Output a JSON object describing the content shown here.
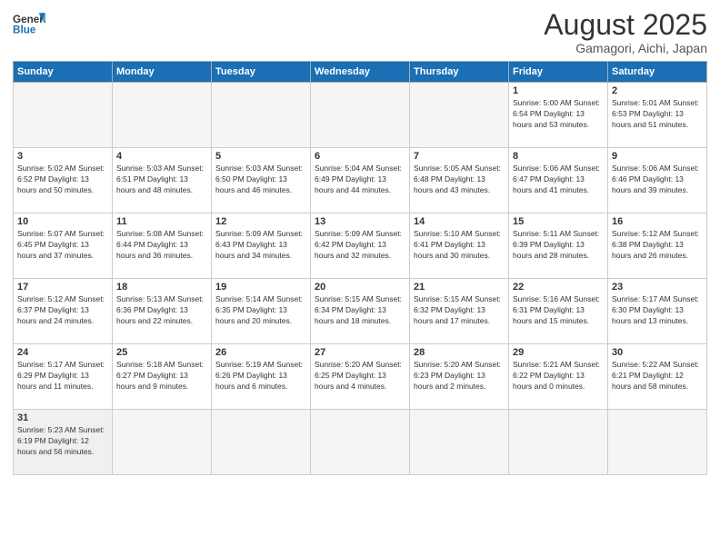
{
  "logo": {
    "general": "General",
    "blue": "Blue"
  },
  "title": "August 2025",
  "location": "Gamagori, Aichi, Japan",
  "days_of_week": [
    "Sunday",
    "Monday",
    "Tuesday",
    "Wednesday",
    "Thursday",
    "Friday",
    "Saturday"
  ],
  "weeks": [
    [
      {
        "day": "",
        "info": ""
      },
      {
        "day": "",
        "info": ""
      },
      {
        "day": "",
        "info": ""
      },
      {
        "day": "",
        "info": ""
      },
      {
        "day": "",
        "info": ""
      },
      {
        "day": "1",
        "info": "Sunrise: 5:00 AM\nSunset: 6:54 PM\nDaylight: 13 hours and 53 minutes."
      },
      {
        "day": "2",
        "info": "Sunrise: 5:01 AM\nSunset: 6:53 PM\nDaylight: 13 hours and 51 minutes."
      }
    ],
    [
      {
        "day": "3",
        "info": "Sunrise: 5:02 AM\nSunset: 6:52 PM\nDaylight: 13 hours and 50 minutes."
      },
      {
        "day": "4",
        "info": "Sunrise: 5:03 AM\nSunset: 6:51 PM\nDaylight: 13 hours and 48 minutes."
      },
      {
        "day": "5",
        "info": "Sunrise: 5:03 AM\nSunset: 6:50 PM\nDaylight: 13 hours and 46 minutes."
      },
      {
        "day": "6",
        "info": "Sunrise: 5:04 AM\nSunset: 6:49 PM\nDaylight: 13 hours and 44 minutes."
      },
      {
        "day": "7",
        "info": "Sunrise: 5:05 AM\nSunset: 6:48 PM\nDaylight: 13 hours and 43 minutes."
      },
      {
        "day": "8",
        "info": "Sunrise: 5:06 AM\nSunset: 6:47 PM\nDaylight: 13 hours and 41 minutes."
      },
      {
        "day": "9",
        "info": "Sunrise: 5:06 AM\nSunset: 6:46 PM\nDaylight: 13 hours and 39 minutes."
      }
    ],
    [
      {
        "day": "10",
        "info": "Sunrise: 5:07 AM\nSunset: 6:45 PM\nDaylight: 13 hours and 37 minutes."
      },
      {
        "day": "11",
        "info": "Sunrise: 5:08 AM\nSunset: 6:44 PM\nDaylight: 13 hours and 36 minutes."
      },
      {
        "day": "12",
        "info": "Sunrise: 5:09 AM\nSunset: 6:43 PM\nDaylight: 13 hours and 34 minutes."
      },
      {
        "day": "13",
        "info": "Sunrise: 5:09 AM\nSunset: 6:42 PM\nDaylight: 13 hours and 32 minutes."
      },
      {
        "day": "14",
        "info": "Sunrise: 5:10 AM\nSunset: 6:41 PM\nDaylight: 13 hours and 30 minutes."
      },
      {
        "day": "15",
        "info": "Sunrise: 5:11 AM\nSunset: 6:39 PM\nDaylight: 13 hours and 28 minutes."
      },
      {
        "day": "16",
        "info": "Sunrise: 5:12 AM\nSunset: 6:38 PM\nDaylight: 13 hours and 26 minutes."
      }
    ],
    [
      {
        "day": "17",
        "info": "Sunrise: 5:12 AM\nSunset: 6:37 PM\nDaylight: 13 hours and 24 minutes."
      },
      {
        "day": "18",
        "info": "Sunrise: 5:13 AM\nSunset: 6:36 PM\nDaylight: 13 hours and 22 minutes."
      },
      {
        "day": "19",
        "info": "Sunrise: 5:14 AM\nSunset: 6:35 PM\nDaylight: 13 hours and 20 minutes."
      },
      {
        "day": "20",
        "info": "Sunrise: 5:15 AM\nSunset: 6:34 PM\nDaylight: 13 hours and 18 minutes."
      },
      {
        "day": "21",
        "info": "Sunrise: 5:15 AM\nSunset: 6:32 PM\nDaylight: 13 hours and 17 minutes."
      },
      {
        "day": "22",
        "info": "Sunrise: 5:16 AM\nSunset: 6:31 PM\nDaylight: 13 hours and 15 minutes."
      },
      {
        "day": "23",
        "info": "Sunrise: 5:17 AM\nSunset: 6:30 PM\nDaylight: 13 hours and 13 minutes."
      }
    ],
    [
      {
        "day": "24",
        "info": "Sunrise: 5:17 AM\nSunset: 6:29 PM\nDaylight: 13 hours and 11 minutes."
      },
      {
        "day": "25",
        "info": "Sunrise: 5:18 AM\nSunset: 6:27 PM\nDaylight: 13 hours and 9 minutes."
      },
      {
        "day": "26",
        "info": "Sunrise: 5:19 AM\nSunset: 6:26 PM\nDaylight: 13 hours and 6 minutes."
      },
      {
        "day": "27",
        "info": "Sunrise: 5:20 AM\nSunset: 6:25 PM\nDaylight: 13 hours and 4 minutes."
      },
      {
        "day": "28",
        "info": "Sunrise: 5:20 AM\nSunset: 6:23 PM\nDaylight: 13 hours and 2 minutes."
      },
      {
        "day": "29",
        "info": "Sunrise: 5:21 AM\nSunset: 6:22 PM\nDaylight: 13 hours and 0 minutes."
      },
      {
        "day": "30",
        "info": "Sunrise: 5:22 AM\nSunset: 6:21 PM\nDaylight: 12 hours and 58 minutes."
      }
    ],
    [
      {
        "day": "31",
        "info": "Sunrise: 5:23 AM\nSunset: 6:19 PM\nDaylight: 12 hours and 56 minutes."
      },
      {
        "day": "",
        "info": ""
      },
      {
        "day": "",
        "info": ""
      },
      {
        "day": "",
        "info": ""
      },
      {
        "day": "",
        "info": ""
      },
      {
        "day": "",
        "info": ""
      },
      {
        "day": "",
        "info": ""
      }
    ]
  ]
}
